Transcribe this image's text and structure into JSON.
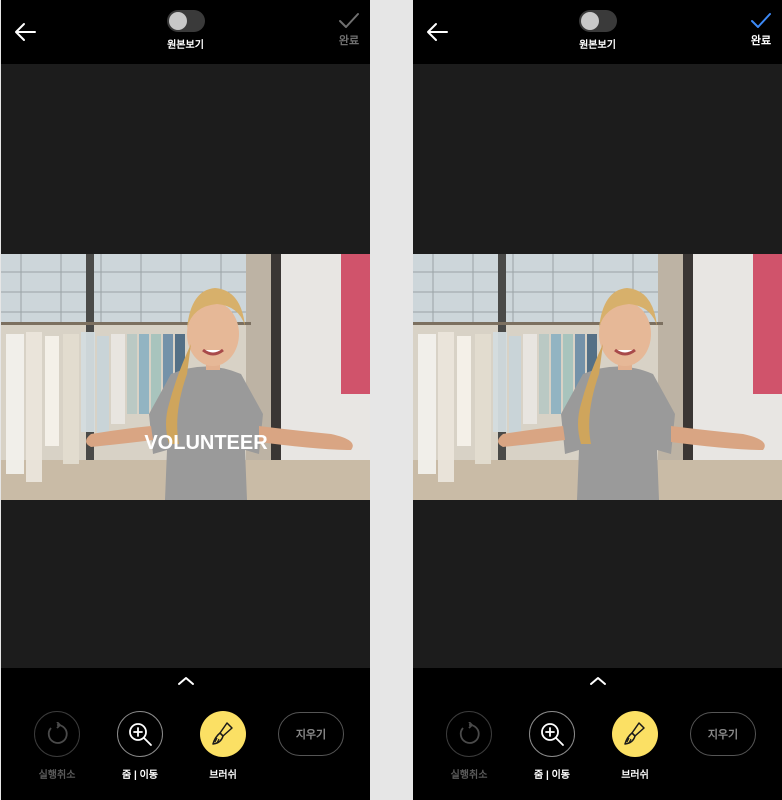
{
  "screens": [
    {
      "id": "left",
      "toggle_label": "원본보기",
      "done_label": "완료",
      "done_state": "inactive",
      "photo_shirt_text": "VOLUNTEER",
      "tools": {
        "undo_label": "실행취소",
        "zoom_label": "줌 | 이동",
        "brush_label": "브러쉬",
        "erase_label": "지우기"
      }
    },
    {
      "id": "right",
      "toggle_label": "원본보기",
      "done_label": "완료",
      "done_state": "active",
      "photo_shirt_text": "",
      "tools": {
        "undo_label": "실행취소",
        "zoom_label": "줌 | 이동",
        "brush_label": "브러쉬",
        "erase_label": "지우기"
      }
    }
  ],
  "icons": {
    "back": "arrow-left-icon",
    "done": "checkmark-icon",
    "expand": "chevron-up-icon",
    "undo": "undo-icon",
    "zoom": "zoom-in-icon",
    "brush": "brush-icon"
  },
  "colors": {
    "canvas_bg": "#1c1c1c",
    "bar_bg": "#000000",
    "brush_active": "#fbe064",
    "done_check_inactive": "#707070",
    "done_check_active": "#3d8af7"
  }
}
